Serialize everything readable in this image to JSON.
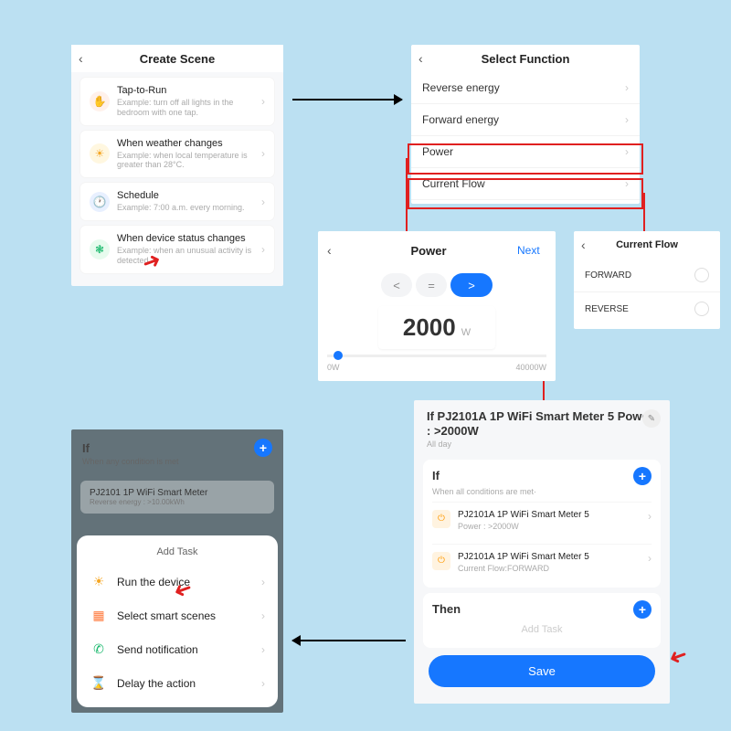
{
  "colors": {
    "accent": "#1677ff",
    "highlight": "#e02020"
  },
  "createScene": {
    "title": "Create Scene",
    "items": [
      {
        "title": "Tap-to-Run",
        "desc": "Example: turn off all lights in the bedroom with one tap."
      },
      {
        "title": "When weather changes",
        "desc": "Example: when local temperature is greater than 28°C."
      },
      {
        "title": "Schedule",
        "desc": "Example: 7:00 a.m. every morning."
      },
      {
        "title": "When device status changes",
        "desc": "Example: when an unusual activity is detected."
      }
    ]
  },
  "selectFunction": {
    "title": "Select Function",
    "items": [
      "Reverse energy",
      "Forward energy",
      "Power",
      "Current Flow"
    ]
  },
  "power": {
    "title": "Power",
    "next": "Next",
    "ops": {
      "lt": "<",
      "eq": "=",
      "gt": ">"
    },
    "value": "2000",
    "unit": "W",
    "min": "0W",
    "max": "40000W"
  },
  "currentFlow": {
    "title": "Current Flow",
    "opts": [
      "FORWARD",
      "REVERSE"
    ]
  },
  "automation": {
    "title": "If PJ2101A 1P WiFi Smart Meter  5 Power : >2000W",
    "subtitle": "All day",
    "if": {
      "title": "If",
      "sub": "When all conditions are met·",
      "conds": [
        {
          "name": "PJ2101A 1P WiFi Smart Meter 5",
          "detail": "Power : >2000W"
        },
        {
          "name": "PJ2101A 1P WiFi Smart Meter 5",
          "detail": "Current Flow:FORWARD"
        }
      ]
    },
    "then": {
      "title": "Then",
      "placeholder": "Add Task"
    },
    "save": "Save"
  },
  "addTask": {
    "dimTitle": "If",
    "dimSub": "When any condition is met",
    "dimCond": {
      "name": "PJ2101 1P WiFi Smart Meter",
      "detail": "Reverse energy : >10.00kWh"
    },
    "sheetTitle": "Add Task",
    "options": [
      "Run the device",
      "Select smart scenes",
      "Send notification",
      "Delay the action"
    ]
  }
}
